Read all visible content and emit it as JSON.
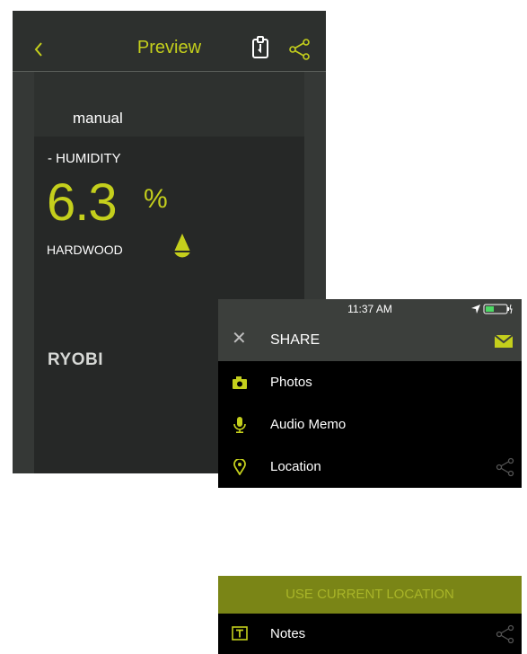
{
  "preview": {
    "title": "Preview",
    "mode": "manual",
    "measurement_label": "- HUMIDITY",
    "reading_value": "6.3",
    "reading_unit": "%",
    "material": "HARDWOOD",
    "brand": "RYOBI"
  },
  "share": {
    "status_time": "11:37 AM",
    "title": "SHARE",
    "items": [
      {
        "label": "Photos",
        "icon": "camera-icon"
      },
      {
        "label": "Audio Memo",
        "icon": "microphone-icon"
      },
      {
        "label": "Location",
        "icon": "location-pin-icon"
      }
    ]
  },
  "bottom": {
    "use_location_label": "USE CURRENT LOCATION",
    "notes_label": "Notes"
  },
  "colors": {
    "accent": "#c4cf1c",
    "dark_bg": "#2a2c2b",
    "header_bg": "#3c3f3c",
    "button_bg": "#7a8516"
  }
}
